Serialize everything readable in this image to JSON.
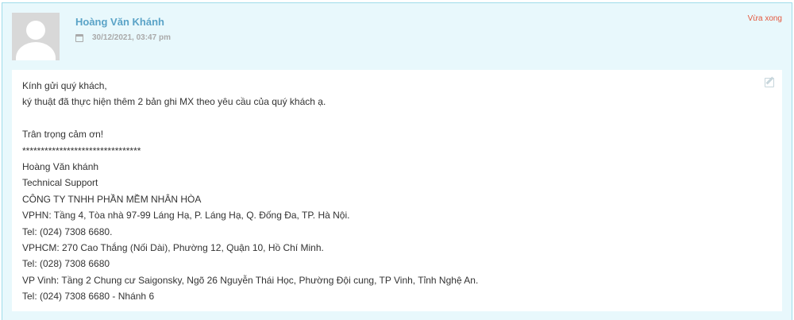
{
  "comment": {
    "author": "Hoàng Văn Khánh",
    "datetime": "30/12/2021, 03:47 pm",
    "status": "Vừa xong",
    "lines": [
      "Kính gửi quý khách,",
      "ký thuật đã thực hiện thêm 2 bản ghi MX theo yêu cầu của quý khách ạ.",
      "",
      "Trân trọng cảm ơn!",
      "********************************",
      "Hoàng Văn khánh",
      "Technical Support",
      "CÔNG TY TNHH PHẦN MỀM NHÂN HÒA",
      "VPHN: Tầng 4, Tòa nhà 97-99 Láng Hạ, P. Láng Hạ, Q. Đống Đa, TP. Hà Nội.",
      "Tel: (024) 7308 6680.",
      "VPHCM: 270 Cao Thắng (Nối Dài), Phường 12, Quận 10, Hồ Chí Minh.",
      "Tel: (028) 7308 6680",
      "VP Vinh: Tầng 2 Chung cư Saigonsky, Ngõ 26 Nguyễn Thái Học, Phường Đội cung, TP Vinh, Tỉnh Nghệ An.",
      "Tel: (024) 7308 6680 - Nhánh 6"
    ]
  },
  "icons": {
    "avatar": "user-avatar-placeholder",
    "date": "calendar-icon",
    "edit": "edit-icon"
  },
  "colors": {
    "panel_bg": "#e8f8fc",
    "border": "#9fdcea",
    "author": "#5aa3c7",
    "status": "#e4583e"
  }
}
